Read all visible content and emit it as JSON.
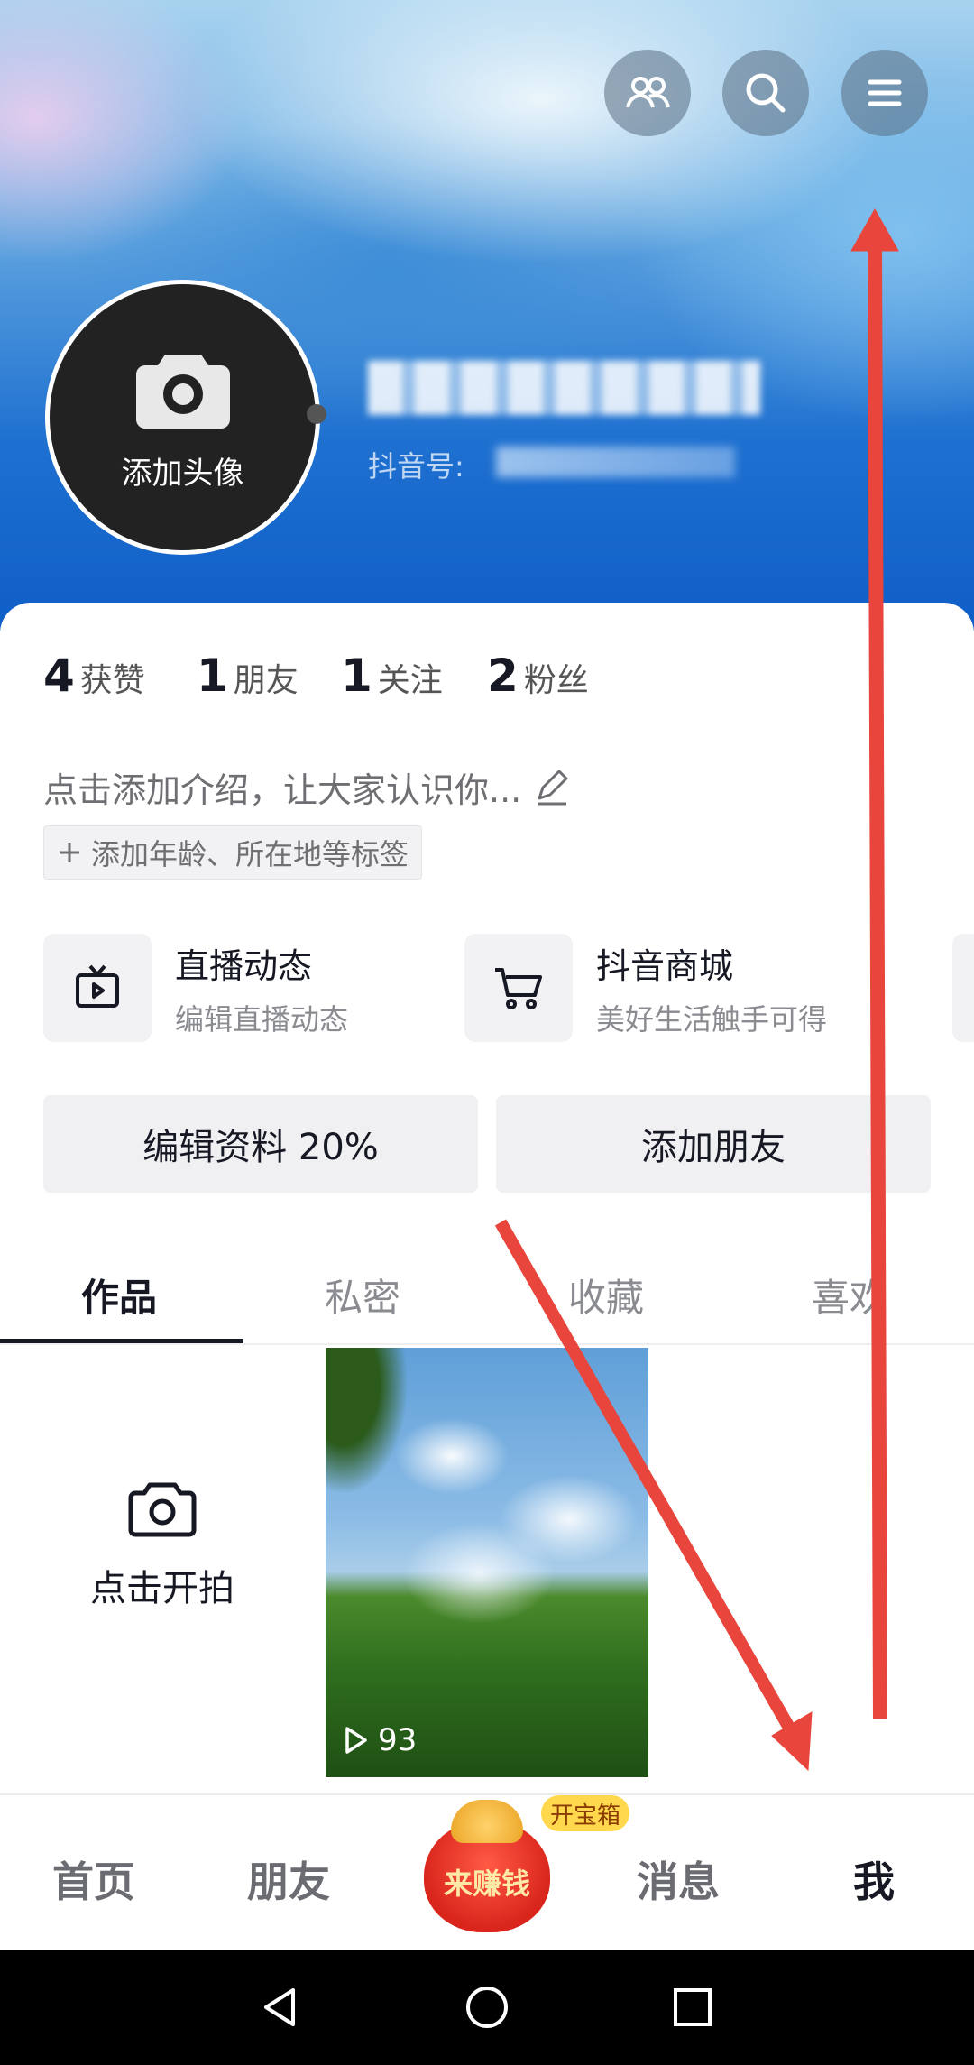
{
  "header": {
    "avatar_label": "添加头像",
    "douyin_id_label": "抖音号:"
  },
  "stats": [
    {
      "count": "4",
      "label": "获赞"
    },
    {
      "count": "1",
      "label": "朋友"
    },
    {
      "count": "1",
      "label": "关注"
    },
    {
      "count": "2",
      "label": "粉丝"
    }
  ],
  "bio": {
    "placeholder": "点击添加介绍，让大家认识你...",
    "tag_button": "添加年龄、所在地等标签"
  },
  "features": [
    {
      "title": "直播动态",
      "subtitle": "编辑直播动态",
      "icon": "tv-icon"
    },
    {
      "title": "抖音商城",
      "subtitle": "美好生活触手可得",
      "icon": "cart-icon"
    }
  ],
  "actions": {
    "edit_profile": "编辑资料 20%",
    "add_friend": "添加朋友"
  },
  "tabs": [
    "作品",
    "私密",
    "收藏",
    "喜欢"
  ],
  "works": {
    "shoot_label": "点击开拍",
    "video_views": "93"
  },
  "bottom_nav": {
    "home": "首页",
    "friends": "朋友",
    "earn": "来赚钱",
    "treasure_badge": "开宝箱",
    "messages": "消息",
    "me": "我"
  },
  "colors": {
    "annotation_arrow": "#e8453c",
    "text_primary": "#161823",
    "text_secondary": "#8a8b91"
  }
}
